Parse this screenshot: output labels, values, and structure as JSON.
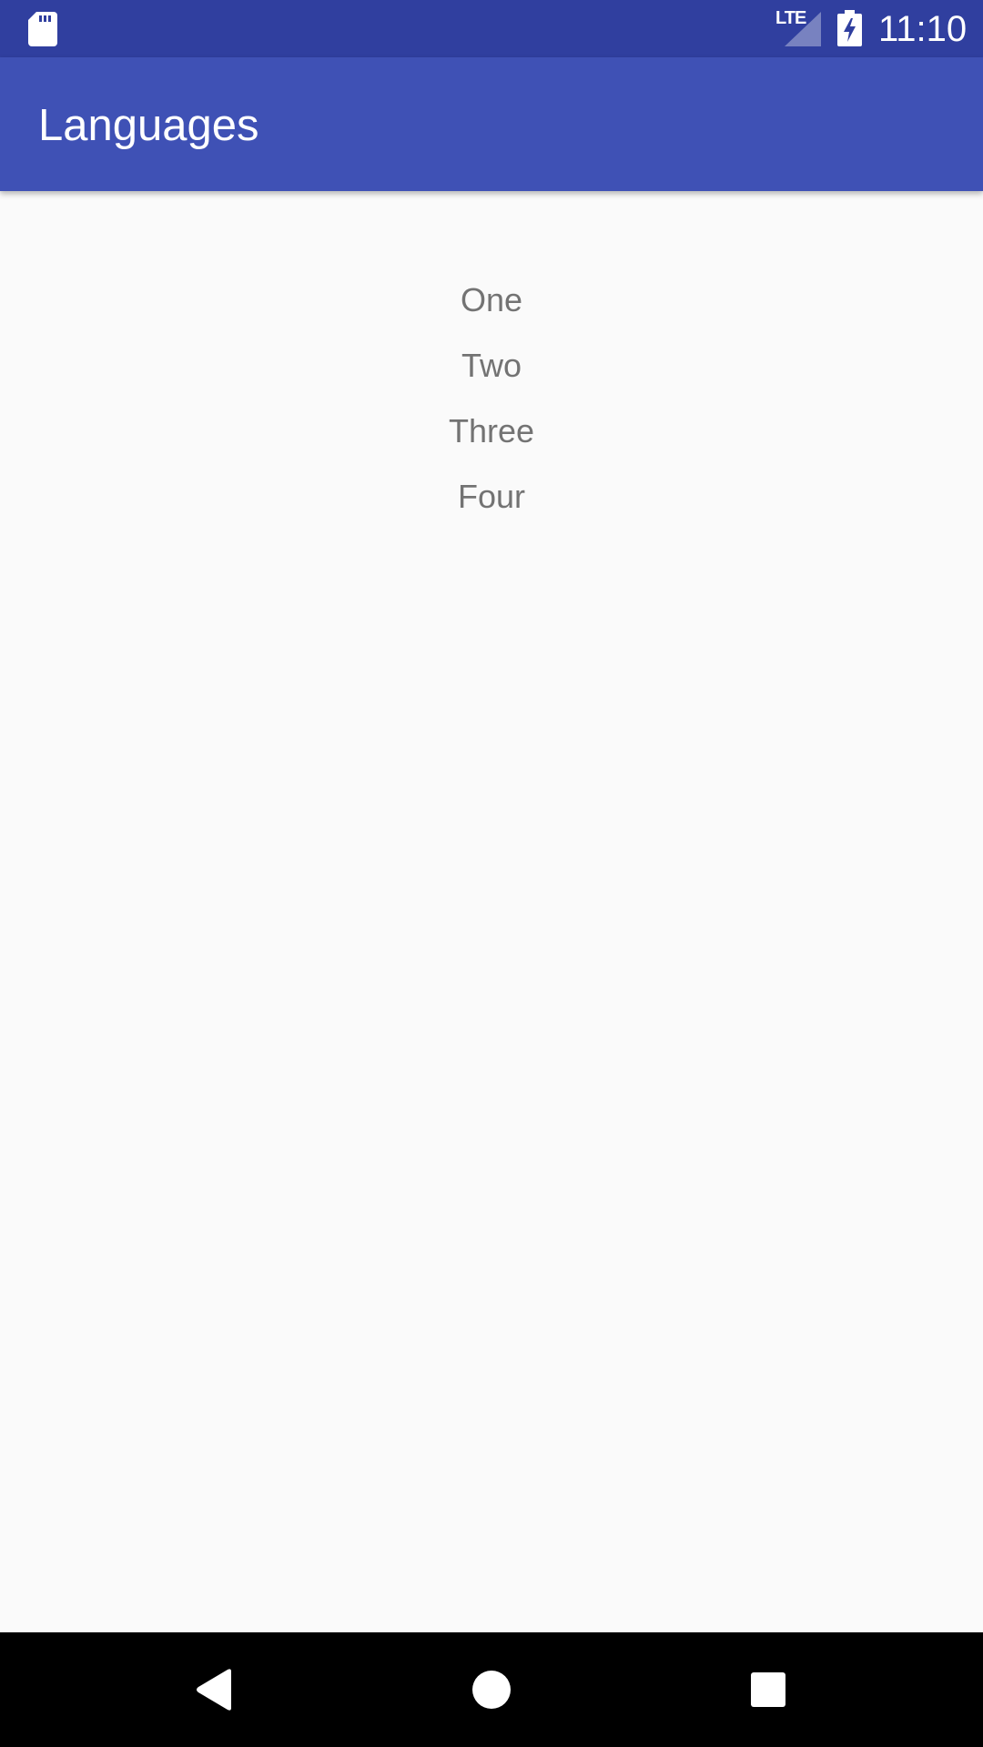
{
  "status_bar": {
    "network_type": "LTE",
    "time": "11:10",
    "icons": [
      "sd-card-icon",
      "signal-icon",
      "battery-charging-icon"
    ]
  },
  "app_bar": {
    "title": "Languages"
  },
  "list": {
    "items": [
      {
        "label": "One"
      },
      {
        "label": "Two"
      },
      {
        "label": "Three"
      },
      {
        "label": "Four"
      }
    ]
  },
  "nav_bar": {
    "icons": [
      "back-icon",
      "home-icon",
      "recent-apps-icon"
    ]
  },
  "colors": {
    "status_bar": "#303f9f",
    "app_bar": "#3f51b5",
    "background": "#fafafa",
    "list_text": "#737373",
    "nav_bar": "#000000"
  }
}
